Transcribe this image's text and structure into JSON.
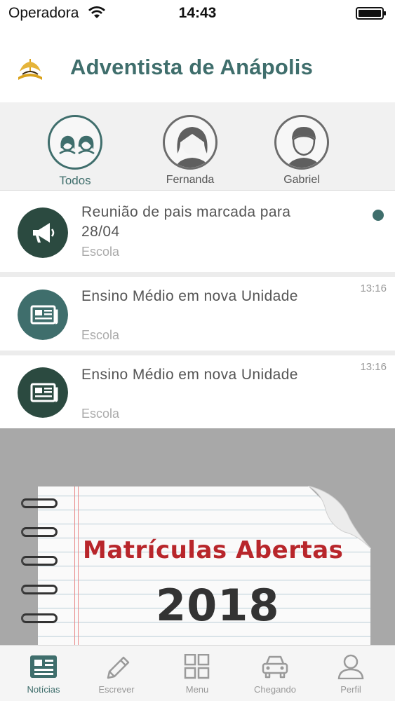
{
  "status_bar": {
    "carrier": "Operadora",
    "time": "14:43"
  },
  "header": {
    "title": "Adventista de Anápolis"
  },
  "filters": [
    {
      "label": "Todos",
      "icon": "two-people-icon",
      "active": true
    },
    {
      "label": "Fernanda",
      "icon": "girl-avatar-icon",
      "active": false
    },
    {
      "label": "Gabriel",
      "icon": "boy-avatar-icon",
      "active": false
    }
  ],
  "news": [
    {
      "title": "Reunião de pais marcada para 28/04",
      "source": "Escola",
      "time": "",
      "icon": "megaphone-icon",
      "unread": true
    },
    {
      "title": "Ensino Médio em nova Unidade",
      "source": "Escola",
      "time": "13:16",
      "icon": "newspaper-icon",
      "unread": false
    },
    {
      "title": "Ensino Médio em nova Unidade",
      "source": "Escola",
      "time": "13:16",
      "icon": "newspaper-icon",
      "unread": false
    }
  ],
  "banner": {
    "headline": "Matrículas Abertas",
    "year": "2018"
  },
  "tabs": [
    {
      "label": "Notícias",
      "icon": "news-icon",
      "active": true
    },
    {
      "label": "Escrever",
      "icon": "pencil-icon",
      "active": false
    },
    {
      "label": "Menu",
      "icon": "grid-icon",
      "active": false
    },
    {
      "label": "Chegando",
      "icon": "car-icon",
      "active": false
    },
    {
      "label": "Perfil",
      "icon": "person-icon",
      "active": false
    }
  ],
  "colors": {
    "accent": "#3f6e6c",
    "dark_icon": "#2b4a40",
    "teal_icon": "#3f6e6c",
    "unread_dot": "#3f6e6c",
    "banner_red": "#b8262b"
  }
}
